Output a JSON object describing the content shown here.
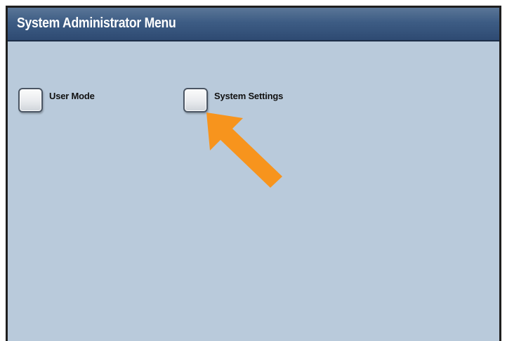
{
  "header": {
    "title": "System Administrator Menu"
  },
  "options": [
    {
      "label": "User Mode"
    },
    {
      "label": "System Settings"
    }
  ],
  "colors": {
    "background": "#b9cadb",
    "title_bar": "#3d5c84",
    "arrow": "#f7941d"
  },
  "annotation": {
    "icon": "orange-arrow-icon"
  }
}
